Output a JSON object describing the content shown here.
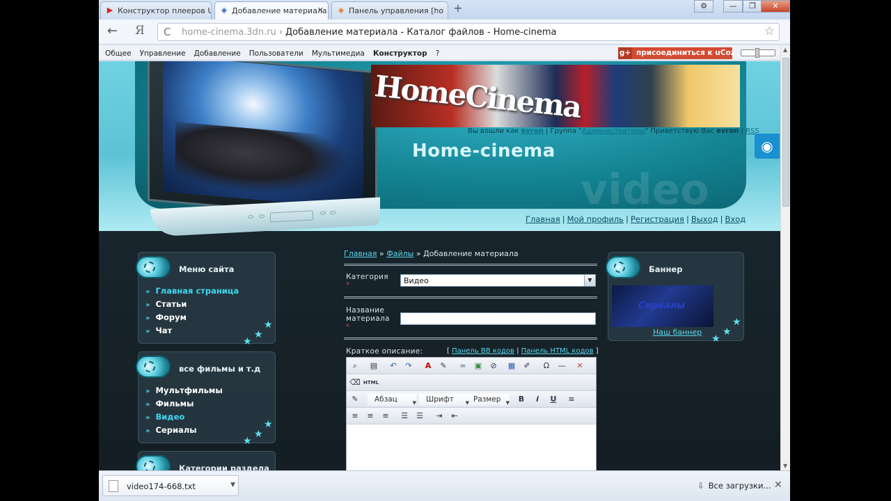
{
  "browser": {
    "tabs": [
      {
        "label": "Конструктор плееров U",
        "icon": "youtube-icon",
        "active": false,
        "closable": false
      },
      {
        "label": "Добавление материала",
        "icon": "ucoz-icon",
        "active": true,
        "closable": true
      },
      {
        "label": "Панель управления [ho",
        "icon": "ucoz-orange-icon",
        "active": false,
        "closable": false
      }
    ],
    "new_tab": "+",
    "window_buttons": {
      "settings": "⚙",
      "minimize": "—",
      "maximize": "❐",
      "close": "✕"
    },
    "back": "←",
    "yandex": "Я",
    "reload": "C",
    "url_domain": "home-cinema.3dn.ru",
    "url_sep": "›",
    "url_title": "Добавление материала - Каталог файлов - Home-cinema",
    "star": "☆"
  },
  "ucoz_panel": {
    "menu": [
      "Общее",
      "Управление",
      "Добавление",
      "Пользователи",
      "Мультимедиа",
      "Конструктор",
      "?"
    ],
    "join_g": "g+",
    "join_label": "присоединиться к uCoz"
  },
  "site": {
    "banner_text": "HomeCinema",
    "login_info": {
      "prefix": "Вы вошли как ",
      "user": "evron",
      "group_prefix": " | Группа \"",
      "group": "Администраторы",
      "greeting": "\" Приветствую Вас ",
      "user2": "evron",
      "rss_sep": " | ",
      "rss": "RSS"
    },
    "name": "Home-cinema",
    "watermark": "video",
    "topnav": [
      "Главная",
      "Мой профиль",
      "Регистрация",
      "Выход",
      "Вход"
    ],
    "topnav_sep": "|"
  },
  "left_blocks": [
    {
      "title": "Меню сайта",
      "items": [
        {
          "label": "Главная страница",
          "active": true
        },
        {
          "label": "Статьи",
          "active": false
        },
        {
          "label": "Форум",
          "active": false
        },
        {
          "label": "Чат",
          "active": false
        }
      ]
    },
    {
      "title": "все фильмы и т.д",
      "items": [
        {
          "label": "Мультфильмы",
          "active": false
        },
        {
          "label": "Фильмы",
          "active": false
        },
        {
          "label": "Видео",
          "active": true
        },
        {
          "label": "Сериалы",
          "active": false
        }
      ]
    },
    {
      "title": "Категории раздела",
      "items": []
    }
  ],
  "content": {
    "breadcrumb": {
      "home": "Главная",
      "sep": "»",
      "files": "Файлы",
      "current": "Добавление материала"
    },
    "category_label": "Категория",
    "required_mark": "*",
    "category_value": "Видео",
    "title_label_1": "Название",
    "title_label_2": "материала",
    "title_value": "",
    "short_desc_label": "Краткое описание:",
    "panel_bb": "Панель BB кодов",
    "panel_html": "Панель HTML кодов",
    "editor": {
      "paragraph": "Абзац",
      "font": "Шрифт",
      "size": "Размер",
      "bold": "B",
      "italic": "i",
      "underline": "U"
    }
  },
  "right_block": {
    "title": "Баннер",
    "banner_text": "Сериалы",
    "link": "Наш баннер"
  },
  "downloads": {
    "file": "video174-668.txt",
    "all": "Все загрузки...",
    "close": "✕"
  }
}
